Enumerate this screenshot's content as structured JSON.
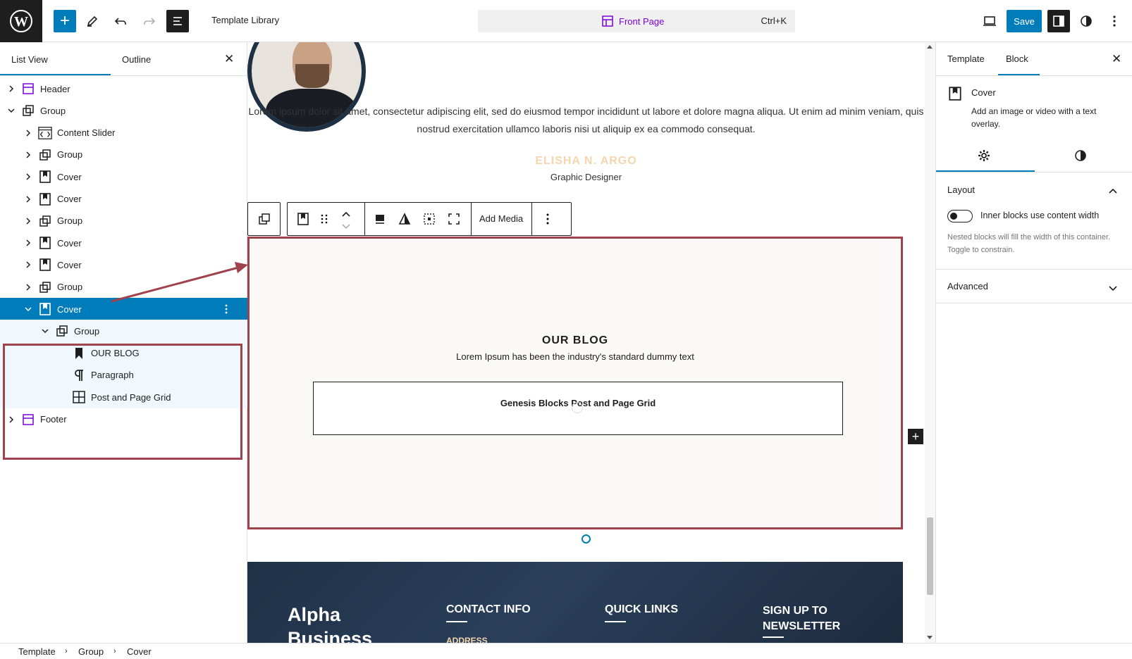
{
  "topbar": {
    "title": "Template Library",
    "command_page": "Front Page",
    "command_shortcut": "Ctrl+K",
    "save_label": "Save"
  },
  "left_panel": {
    "tabs": [
      "List View",
      "Outline"
    ],
    "tree": [
      {
        "label": "Header",
        "icon": "template-part-icon",
        "expanded": false
      },
      {
        "label": "Group",
        "icon": "group-icon",
        "expanded": true
      },
      {
        "label": "Content Slider",
        "icon": "html-icon",
        "expanded": false
      },
      {
        "label": "Group",
        "icon": "group-icon",
        "expanded": false
      },
      {
        "label": "Cover",
        "icon": "cover-icon",
        "expanded": false
      },
      {
        "label": "Cover",
        "icon": "cover-icon",
        "expanded": false
      },
      {
        "label": "Group",
        "icon": "group-icon",
        "expanded": false
      },
      {
        "label": "Cover",
        "icon": "cover-icon",
        "expanded": false
      },
      {
        "label": "Cover",
        "icon": "cover-icon",
        "expanded": false
      },
      {
        "label": "Group",
        "icon": "group-icon",
        "expanded": false
      },
      {
        "label": "Cover",
        "icon": "cover-icon",
        "expanded": true,
        "selected": true
      },
      {
        "label": "Group",
        "icon": "group-icon",
        "expanded": true
      },
      {
        "label": "OUR BLOG",
        "icon": "heading-icon"
      },
      {
        "label": "Paragraph",
        "icon": "paragraph-icon"
      },
      {
        "label": "Post and Page Grid",
        "icon": "grid-icon"
      },
      {
        "label": "Footer",
        "icon": "template-part-icon",
        "expanded": false
      }
    ]
  },
  "canvas": {
    "intro_text": "Lorem ipsum dolor sit amet, consectetur adipiscing elit, sed do eiusmod tempor incididunt ut labore et dolore magna aliqua. Ut enim ad minim veniam, quis nostrud exercitation ullamco laboris nisi ut aliquip ex ea commodo consequat.",
    "person_name": "ELISHA N. ARGO",
    "person_role": "Graphic Designer",
    "toolbar_add_media": "Add Media",
    "blog_heading": "OUR BLOG",
    "blog_subtext": "Lorem Ipsum has been the industry's standard dummy text",
    "grid_placeholder": "Genesis Blocks Post and Page Grid",
    "footer": {
      "brand_line1": "Alpha",
      "brand_line2": "Business",
      "contact_title": "CONTACT INFO",
      "contact_sub": "ADDRESS",
      "quick_links_title": "QUICK LINKS",
      "newsletter_line1": "SIGN UP TO",
      "newsletter_line2": "NEWSLETTER"
    }
  },
  "right_panel": {
    "tabs": [
      "Template",
      "Block"
    ],
    "block_name": "Cover",
    "block_desc": "Add an image or video with a text overlay.",
    "layout_title": "Layout",
    "toggle_label": "Inner blocks use content width",
    "toggle_help": "Nested blocks will fill the width of this container. Toggle to constrain.",
    "advanced_title": "Advanced"
  },
  "breadcrumb": [
    "Template",
    "Group",
    "Cover"
  ],
  "colors": {
    "accent": "#007cba",
    "highlight": "#a0424d",
    "name_color": "#f5d5b0",
    "footer_bg": "#1f3147"
  }
}
